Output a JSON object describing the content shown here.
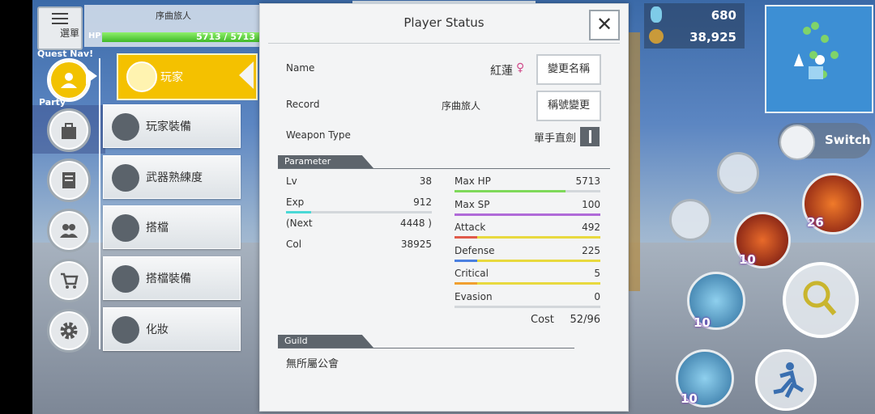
{
  "hud": {
    "menu_label": "選單",
    "player_name": "序曲旅人",
    "hp_label": "HP",
    "hp_text": "5713 / 5713",
    "hp_fraction": 1.0,
    "quest_label": "Quest Nav!",
    "party_label": "Party",
    "resource_1": "680",
    "resource_2": "38,925",
    "switch_label": "Switch",
    "skill_count_1": "26",
    "skill_count_2": "10",
    "skill_count_3": "10",
    "skill_count_4": "10"
  },
  "side_menu": {
    "active": "玩家",
    "items": [
      "玩家裝備",
      "武器熟練度",
      "搭檔",
      "搭檔裝備",
      "化妝"
    ]
  },
  "status": {
    "title": "Player Status",
    "close": "✕",
    "name_label": "Name",
    "name_value": "紅蓮",
    "gender_icon": "♀",
    "rename_button": "變更名稱",
    "record_label": "Record",
    "record_value": "序曲旅人",
    "title_button": "稱號變更",
    "weapon_label": "Weapon Type",
    "weapon_value": "單手直劍",
    "parameter_header": "Parameter",
    "params_left": [
      {
        "label": "Lv",
        "value": "38"
      },
      {
        "label": "Exp",
        "value": "912",
        "bar_fraction": 0.17,
        "bar_color": "#4ad8d6"
      },
      {
        "label": "(Next",
        "value": "4448 )"
      },
      {
        "label": "Col",
        "value": "38925"
      }
    ],
    "params_right": [
      {
        "label": "Max HP",
        "value": "5713",
        "bar_fraction": 0.76,
        "bar_color": "#7ed95a"
      },
      {
        "label": "Max SP",
        "value": "100",
        "bar_fraction": 1.0,
        "bar_color": "#b06ad8"
      },
      {
        "label": "Attack",
        "value": "492",
        "bar_fraction": 1.0,
        "bar_color": "#e8d93e",
        "mark_color": "#e05a4a"
      },
      {
        "label": "Defense",
        "value": "225",
        "bar_fraction": 1.0,
        "bar_color": "#e8d93e",
        "mark_color": "#4a7fe0"
      },
      {
        "label": "Critical",
        "value": "5",
        "bar_fraction": 1.0,
        "bar_color": "#e8d93e",
        "mark_color": "#f0a030"
      },
      {
        "label": "Evasion",
        "value": "0",
        "bar_fraction": 0.0,
        "bar_color": "#d3d7db"
      }
    ],
    "cost_label": "Cost",
    "cost_value": "52/96",
    "guild_header": "Guild",
    "guild_value": "無所屬公會"
  },
  "colors": {
    "accent": "#f4c100",
    "panel": "#f3f4f5",
    "hp": "#5fd33c"
  }
}
